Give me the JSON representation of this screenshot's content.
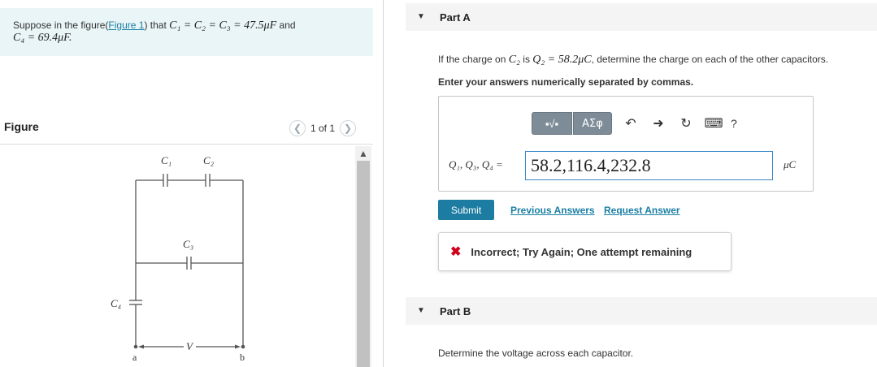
{
  "problem": {
    "prefix": "Suppose in the figure(",
    "figure_link": "Figure 1",
    "suffix": ") that ",
    "eq1": "C₁ = C₂ = C₃ = 47.5μF",
    "and": " and",
    "eq2": "C₄ = 69.4μF."
  },
  "figure": {
    "title": "Figure",
    "pager": "1 of 1",
    "labels": {
      "c1": "C₁",
      "c2": "C₂",
      "c3": "C₃",
      "c4": "C₄",
      "a": "a",
      "b": "b",
      "v": "V"
    }
  },
  "partA": {
    "label": "Part A",
    "question_prefix": "If the charge on ",
    "question_c2": "C₂",
    "question_mid": " is ",
    "question_q": "Q₂ = 58.2μC",
    "question_suffix": ", determine the charge on each of the other capacitors.",
    "instruction": "Enter your answers numerically separated by commas.",
    "toolbar": {
      "frac": "▪√▪",
      "greek": "ΑΣφ",
      "help": "?"
    },
    "answer_label": "Q₁, Q₃, Q₄ =",
    "answer_value": "58.2,116.4,232.8",
    "unit": "μC",
    "submit": "Submit",
    "previous_answers": "Previous Answers",
    "request_answer": "Request Answer",
    "feedback": "Incorrect; Try Again; One attempt remaining"
  },
  "partB": {
    "label": "Part B",
    "question": "Determine the voltage across each capacitor."
  },
  "colors": {
    "accent": "#1d7ca2",
    "link": "#1a7fa3",
    "error": "#d0021b",
    "problem_bg": "#e9f5f7"
  }
}
